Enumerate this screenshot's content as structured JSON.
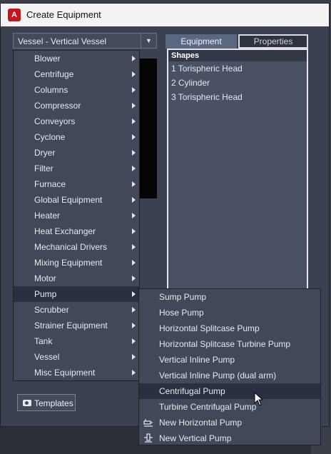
{
  "window": {
    "title": "Create Equipment",
    "app_icon_letter": "A"
  },
  "equipment_select": {
    "value": "Vessel - Vertical Vessel"
  },
  "tabs": [
    {
      "label": "Equipment"
    },
    {
      "label": "Properties"
    }
  ],
  "shapes": {
    "header": "Shapes",
    "items": [
      "1 Torispheric Head",
      "2 Cylinder",
      "3 Torispheric Head"
    ]
  },
  "category_menu": {
    "items": [
      {
        "label": "Blower"
      },
      {
        "label": "Centrifuge"
      },
      {
        "label": "Columns"
      },
      {
        "label": "Compressor"
      },
      {
        "label": "Conveyors"
      },
      {
        "label": "Cyclone"
      },
      {
        "label": "Dryer"
      },
      {
        "label": "Filter"
      },
      {
        "label": "Furnace"
      },
      {
        "label": "Global Equipment"
      },
      {
        "label": "Heater"
      },
      {
        "label": "Heat Exchanger"
      },
      {
        "label": "Mechanical Drivers"
      },
      {
        "label": "Mixing Equipment"
      },
      {
        "label": "Motor"
      },
      {
        "label": "Pump"
      },
      {
        "label": "Scrubber"
      },
      {
        "label": "Strainer Equipment"
      },
      {
        "label": "Tank"
      },
      {
        "label": "Vessel"
      },
      {
        "label": "Misc Equipment"
      }
    ],
    "highlighted": "Pump"
  },
  "pump_submenu": {
    "items": [
      {
        "label": "Sump Pump"
      },
      {
        "label": "Hose Pump"
      },
      {
        "label": "Horizontal Splitcase Pump"
      },
      {
        "label": "Horizontal Splitcase Turbine Pump"
      },
      {
        "label": "Vertical Inline Pump"
      },
      {
        "label": "Vertical Inline Pump (dual arm)"
      },
      {
        "label": "Centrifugal Pump"
      },
      {
        "label": "Turbine Centrifugal Pump"
      },
      {
        "label": "New Horizontal Pump",
        "icon": "horizontal-pump-icon"
      },
      {
        "label": "New Vertical Pump",
        "icon": "vertical-pump-icon"
      }
    ],
    "highlighted": "Centrifugal Pump"
  },
  "templates_button": {
    "label": "Templates",
    "icon": "camera-icon"
  },
  "colors": {
    "accent": "#c4161c",
    "panel": "#3b4150",
    "menu": "#414859",
    "highlight": "#283041",
    "tab_active": "#5b6781"
  }
}
